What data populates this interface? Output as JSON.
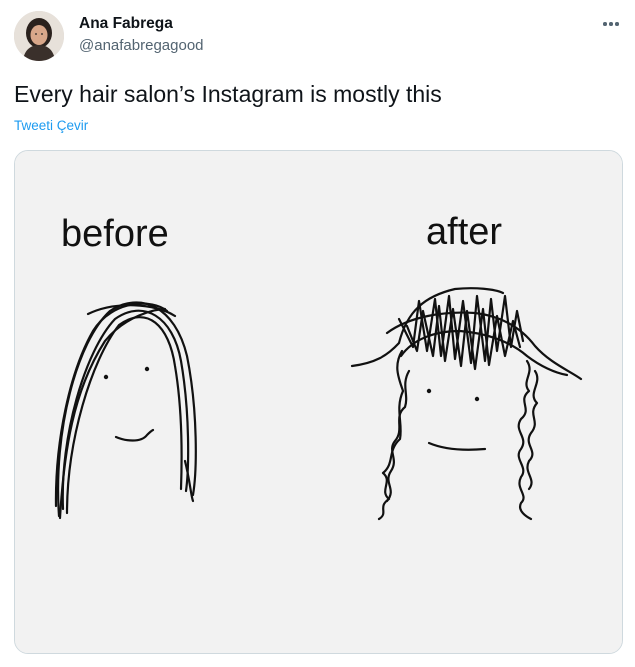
{
  "tweet": {
    "author_name": "Ana Fabrega",
    "author_handle": "@anafabregagood",
    "text": "Every hair salon’s Instagram is mostly this",
    "translate_label": "Tweeti Çevir"
  },
  "media": {
    "label_before": "before",
    "label_after": "after"
  },
  "icons": {
    "more": "more-dots-icon",
    "avatar": "profile-photo"
  },
  "colors": {
    "link": "#1d9bf0",
    "secondary_text": "#536471",
    "border": "#cfd9de"
  }
}
